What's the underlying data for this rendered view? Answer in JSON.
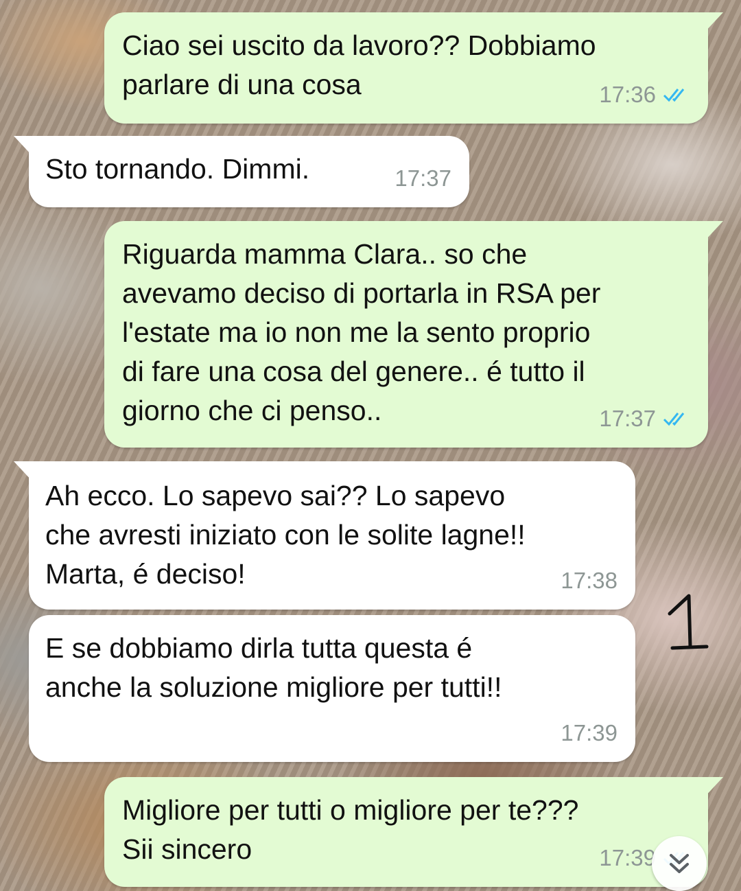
{
  "chat": {
    "messages": [
      {
        "direction": "out",
        "text": "Ciao sei uscito da lavoro?? Dobbiamo\nparlare di una cosa",
        "time": "17:36",
        "status": "read"
      },
      {
        "direction": "in",
        "text": "Sto tornando. Dimmi.",
        "time": "17:37"
      },
      {
        "direction": "out",
        "text": "Riguarda mamma Clara.. so che\navevamo deciso di portarla in RSA per\nl'estate ma io non me la sento proprio\ndi fare una cosa del genere.. é tutto il\ngiorno che ci penso..",
        "time": "17:37",
        "status": "read"
      },
      {
        "direction": "in",
        "text": "Ah ecco. Lo sapevo sai?? Lo sapevo\nche avresti iniziato con le solite lagne!!\nMarta, é deciso!",
        "time": "17:38"
      },
      {
        "direction": "in",
        "text": "E se dobbiamo dirla tutta questa é\nanche la soluzione migliore per tutti!!",
        "time": "17:39"
      },
      {
        "direction": "out",
        "text": "Migliore per tutti o migliore per te???\nSii sincero",
        "time": "17:39",
        "status": "read"
      }
    ]
  },
  "annotation": {
    "handwritten_mark": "1"
  },
  "colors": {
    "outgoing_bubble": "#e3fbd3",
    "incoming_bubble": "#ffffff",
    "read_tick": "#34b7f1",
    "timestamp": "#8d9694"
  },
  "icons": {
    "read_receipt": "double-check-icon",
    "scroll_down": "double-chevron-down-icon"
  }
}
